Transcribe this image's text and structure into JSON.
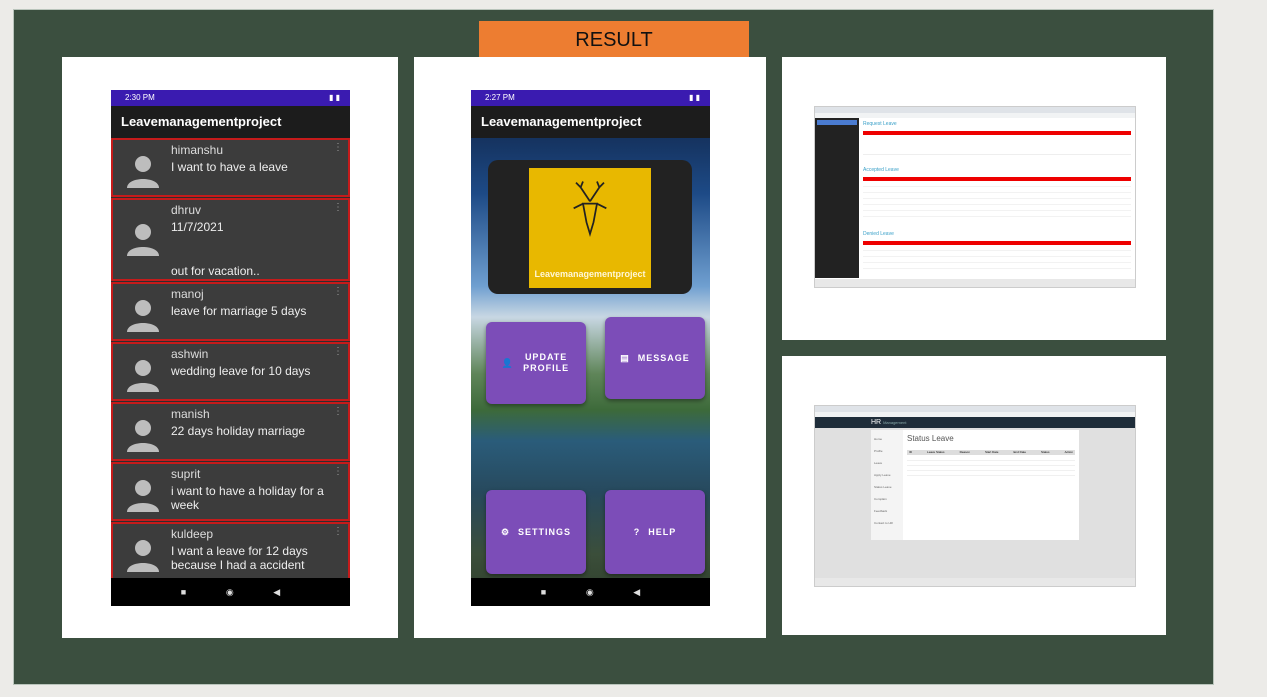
{
  "banner": {
    "label": "RESULT"
  },
  "phone1": {
    "status_time": "2:30 PM",
    "app_title": "Leavemanagementproject",
    "items": [
      {
        "name": "himanshu",
        "msg": "I want to have a leave",
        "extra": ""
      },
      {
        "name": "dhruv",
        "msg": "11/7/2021",
        "extra": "out for vacation.."
      },
      {
        "name": "manoj",
        "msg": "leave for marriage 5 days",
        "extra": ""
      },
      {
        "name": "ashwin",
        "msg": "wedding leave for 10 days",
        "extra": ""
      },
      {
        "name": "manish",
        "msg": "22 days holiday marriage",
        "extra": ""
      },
      {
        "name": "suprit",
        "msg": "i want to have a holiday for a week",
        "extra": ""
      },
      {
        "name": "kuldeep",
        "msg": "I want a leave for 12 days because I had a accident",
        "extra": ""
      }
    ]
  },
  "phone2": {
    "status_time": "2:27 PM",
    "app_title": "Leavemanagementproject",
    "logo_text": "Leavemanagementproject",
    "buttons": {
      "update_profile": "UPDATE PROFILE",
      "message": "MESSAGE",
      "settings": "SETTINGS",
      "help": "HELP"
    }
  },
  "shot1": {
    "section1": "Request Leave",
    "section2": "Accepted Leave",
    "section3": "Denied Leave"
  },
  "shot2": {
    "brand": "HR",
    "brand_sub": "Management",
    "title": "Status Leave",
    "sidebar": [
      "Home",
      "Profile",
      "Leave",
      "Apply Leave",
      "Status Leave",
      "Complain",
      "Feedback",
      "Contact to HR"
    ],
    "columns": [
      "ID",
      "Leave Status",
      "Reason",
      "Start Date",
      "End Date",
      "Status",
      "Action"
    ]
  },
  "colors": {
    "slide": "#3b4f3f",
    "banner": "#ed7d31",
    "item_border": "#c51b1b",
    "button": "#7c4db8",
    "logo": "#e8b800"
  }
}
